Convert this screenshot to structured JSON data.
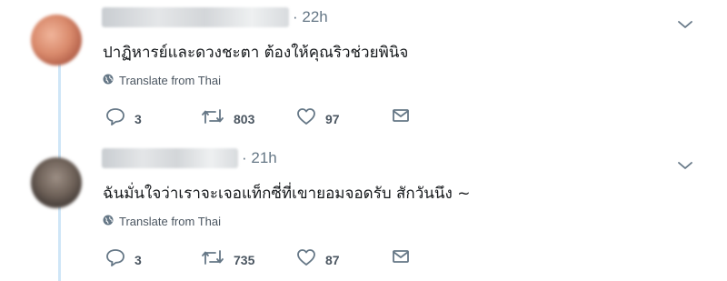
{
  "tweets": [
    {
      "time": "· 22h",
      "text": "ปาฏิหารย์และดวงชะตา ต้องให้คุณริวช่วยพินิจ",
      "translate_label": "Translate from Thai",
      "replies": "3",
      "retweets": "803",
      "likes": "97"
    },
    {
      "time": "· 21h",
      "text": "ฉันมั่นใจว่าเราจะเจอแท็กซี่ที่เขายอมจอดรับ สักวันนึง ~",
      "translate_label": "Translate from Thai",
      "replies": "3",
      "retweets": "735",
      "likes": "87"
    }
  ],
  "icons": {
    "chevron": "chevron-down-icon",
    "translate": "globe-icon",
    "reply": "reply-icon",
    "retweet": "retweet-icon",
    "like": "heart-icon",
    "dm": "envelope-icon"
  },
  "colors": {
    "text": "#14171a",
    "muted": "#657786",
    "thread_line": "#cfe6f7"
  }
}
